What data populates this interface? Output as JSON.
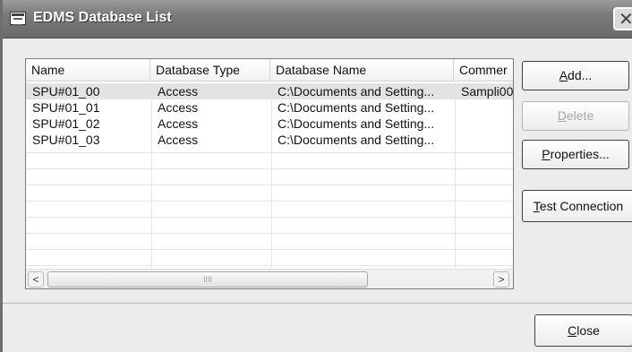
{
  "window": {
    "title": "EDMS Database List",
    "close_glyph": "✕"
  },
  "list": {
    "columns": [
      "Name",
      "Database Type",
      "Database Name",
      "Commer"
    ],
    "rows": [
      [
        "SPU#01_00",
        "Access",
        "C:\\Documents and Setting...",
        "Sampli00"
      ],
      [
        "SPU#01_01",
        "Access",
        "C:\\Documents and Setting...",
        ""
      ],
      [
        "SPU#01_02",
        "Access",
        "C:\\Documents and Setting...",
        ""
      ],
      [
        "SPU#01_03",
        "Access",
        "C:\\Documents and Setting...",
        ""
      ]
    ],
    "selected_row": 0,
    "scroll": {
      "left_glyph": "<",
      "right_glyph": ">",
      "thumb_grip": "IIII"
    }
  },
  "buttons": {
    "add": {
      "mnemonic": "A",
      "rest": "dd..."
    },
    "delete": {
      "mnemonic": "D",
      "rest": "elete"
    },
    "properties": {
      "mnemonic": "P",
      "rest": "roperties..."
    },
    "test_connection": {
      "mnemonic": "T",
      "rest": "est Connection"
    },
    "close": {
      "mnemonic": "C",
      "rest": "lose"
    }
  }
}
